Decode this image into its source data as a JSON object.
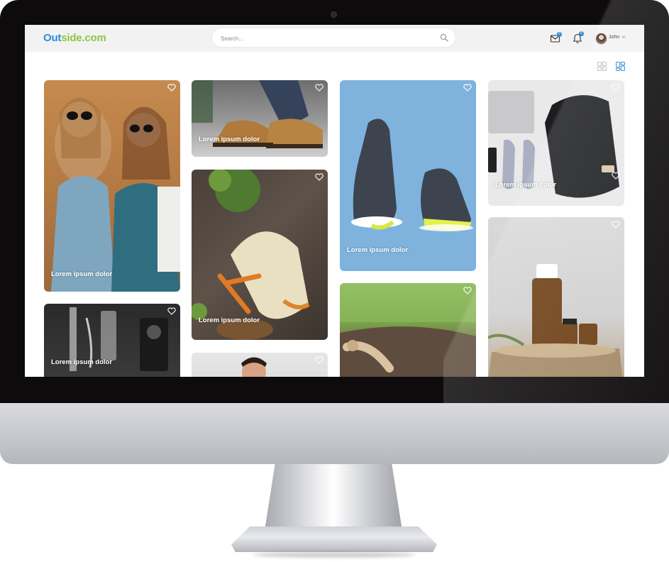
{
  "app": {
    "logo_part1": "Out",
    "logo_part2": "side.com"
  },
  "search": {
    "placeholder": "Search..."
  },
  "header": {
    "mail_badge": "2",
    "bell_badge": "5",
    "user_name": "John"
  },
  "colors": {
    "logo_blue": "#2a8ad8",
    "logo_green": "#8cc63f",
    "topbar": "#f2f2f2",
    "active_view": "#2a8ad8"
  },
  "cards": [
    {
      "label": "Lorem ipsum dolor"
    },
    {
      "label": "Lorem ipsum dolor"
    },
    {
      "label": "Lorem ipsum dolor"
    },
    {
      "label": "Lorem ipsum dolor"
    },
    {
      "label": "Lorem ipsum dolor"
    },
    {
      "label": "Lorem ipsum dolor"
    },
    {
      "label": "Lorem ipsum dolor"
    },
    {
      "label": "Lorem ipsum dolor"
    },
    {
      "label": ""
    }
  ]
}
